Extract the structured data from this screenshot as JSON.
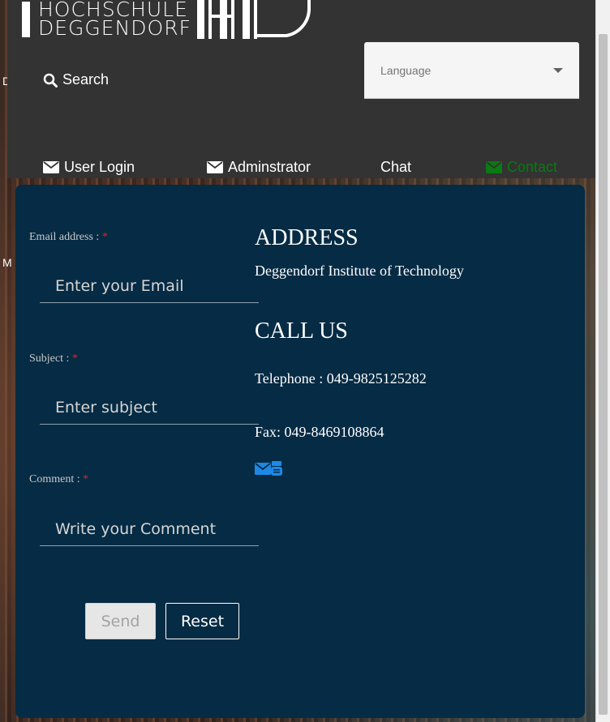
{
  "header": {
    "logo": {
      "line1": "HOCHSCHULE",
      "line2": "DEGGENDORF"
    },
    "search_label": "Search",
    "language": {
      "placeholder": "Language"
    },
    "nav": [
      {
        "label": "User Login",
        "icon": "envelope-icon",
        "active": false
      },
      {
        "label": "Adminstrator",
        "icon": "envelope-icon",
        "active": false
      },
      {
        "label": "Chat",
        "icon": "",
        "active": false
      },
      {
        "label": "Contact",
        "icon": "envelope-icon",
        "active": true
      }
    ],
    "active_color": "#0a7a12"
  },
  "side_letters": [
    "D",
    "M"
  ],
  "form": {
    "email": {
      "label": "Email address : ",
      "required": "*",
      "placeholder": "Enter your Email"
    },
    "subject": {
      "label": "Subject : ",
      "required": "*",
      "placeholder": "Enter subject"
    },
    "comment": {
      "label": "Comment : ",
      "required": "*",
      "placeholder": "Write your Comment"
    },
    "send_label": "Send",
    "reset_label": "Reset"
  },
  "contact": {
    "address_heading": "ADDRESS",
    "address_line": "Deggendorf Institute of Technology",
    "call_heading": "CALL US",
    "telephone": "Telephone : 049-9825125282",
    "fax": "Fax: 049-8469108864",
    "social_icons": [
      "envelope-icon",
      "youtube-icon"
    ]
  },
  "colors": {
    "panel_bg": "#062b44",
    "header_bg": "#333333",
    "required": "#e0262b",
    "icon_blue": "#1e88e5"
  }
}
